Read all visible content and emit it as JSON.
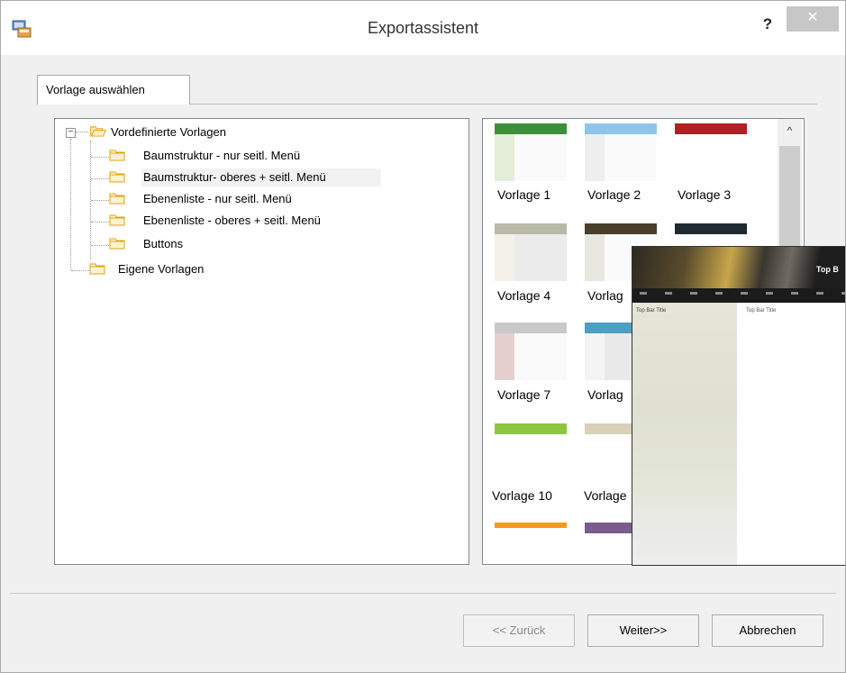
{
  "window": {
    "title": "Exportassistent",
    "help_label": "?",
    "close_label": "✕"
  },
  "tabs": [
    {
      "label": "Vorlage auswählen",
      "selected": true
    }
  ],
  "tree": {
    "root": {
      "label": "Vordefinierte Vorlagen",
      "expanded": true,
      "expander_symbol": "−"
    },
    "children": [
      {
        "label": "Baumstruktur - nur seitl. Menü"
      },
      {
        "label": "Baumstruktur- oberes + seitl. Menü",
        "selected": true
      },
      {
        "label": "Ebenenliste - nur seitl. Menü"
      },
      {
        "label": "Ebenenliste - oberes + seitl. Menü"
      },
      {
        "label": "Buttons"
      }
    ],
    "second_root": {
      "label": "Eigene Vorlagen"
    }
  },
  "gallery": {
    "templates": [
      {
        "label": "Vorlage 1",
        "header_color": "#3e8f3a"
      },
      {
        "label": "Vorlage 2",
        "header_color": "#8fc6e8"
      },
      {
        "label": "Vorlage 3",
        "header_color": "#b21f24"
      },
      {
        "label": "Vorlage 4",
        "header_color": "#b8b9a8"
      },
      {
        "label": "Vorlag",
        "header_color": "#4a3f2c"
      },
      {
        "label": "Vorlage 7",
        "header_color": "#c9c9c9"
      },
      {
        "label": "Vorlag",
        "header_color": "#4aa0c0"
      },
      {
        "label": "Vorlage 10",
        "header_color": "#8ec63f"
      },
      {
        "label": "Vorlage",
        "header_color": "#d8d0b8"
      },
      {
        "label": "",
        "header_color": "#f39a1e"
      },
      {
        "label": "",
        "header_color": "#7c5c8c"
      }
    ],
    "scroll_up_symbol": "^"
  },
  "preview": {
    "banner_title": "Top B",
    "side_text": "Top Bar Title",
    "main_text": "Top Bar Title"
  },
  "buttons": {
    "back": "<< Zurück",
    "next": "Weiter>>",
    "cancel": "Abbrechen"
  },
  "colors": {
    "close_button": "#c7c7c7",
    "window_bg": "#f0f0f0",
    "folder_outline": "#e3a20b",
    "folder_fill": "#fbe9b4"
  }
}
